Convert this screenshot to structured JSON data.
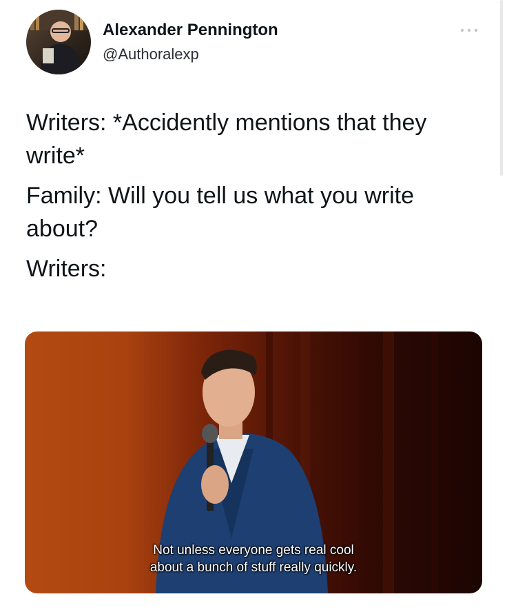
{
  "author": {
    "display_name": "Alexander Pennington",
    "handle": "@Authoralexp",
    "avatar_icon": "profile-photo"
  },
  "actions": {
    "more_icon": "ellipsis-icon"
  },
  "tweet": {
    "lines": [
      "Writers: *Accidently mentions that they write*",
      "Family: Will you tell us what you write about?",
      "Writers:"
    ]
  },
  "media": {
    "subtitle_line_1": "Not unless everyone gets real cool",
    "subtitle_line_2": "about a bunch of stuff really quickly."
  }
}
